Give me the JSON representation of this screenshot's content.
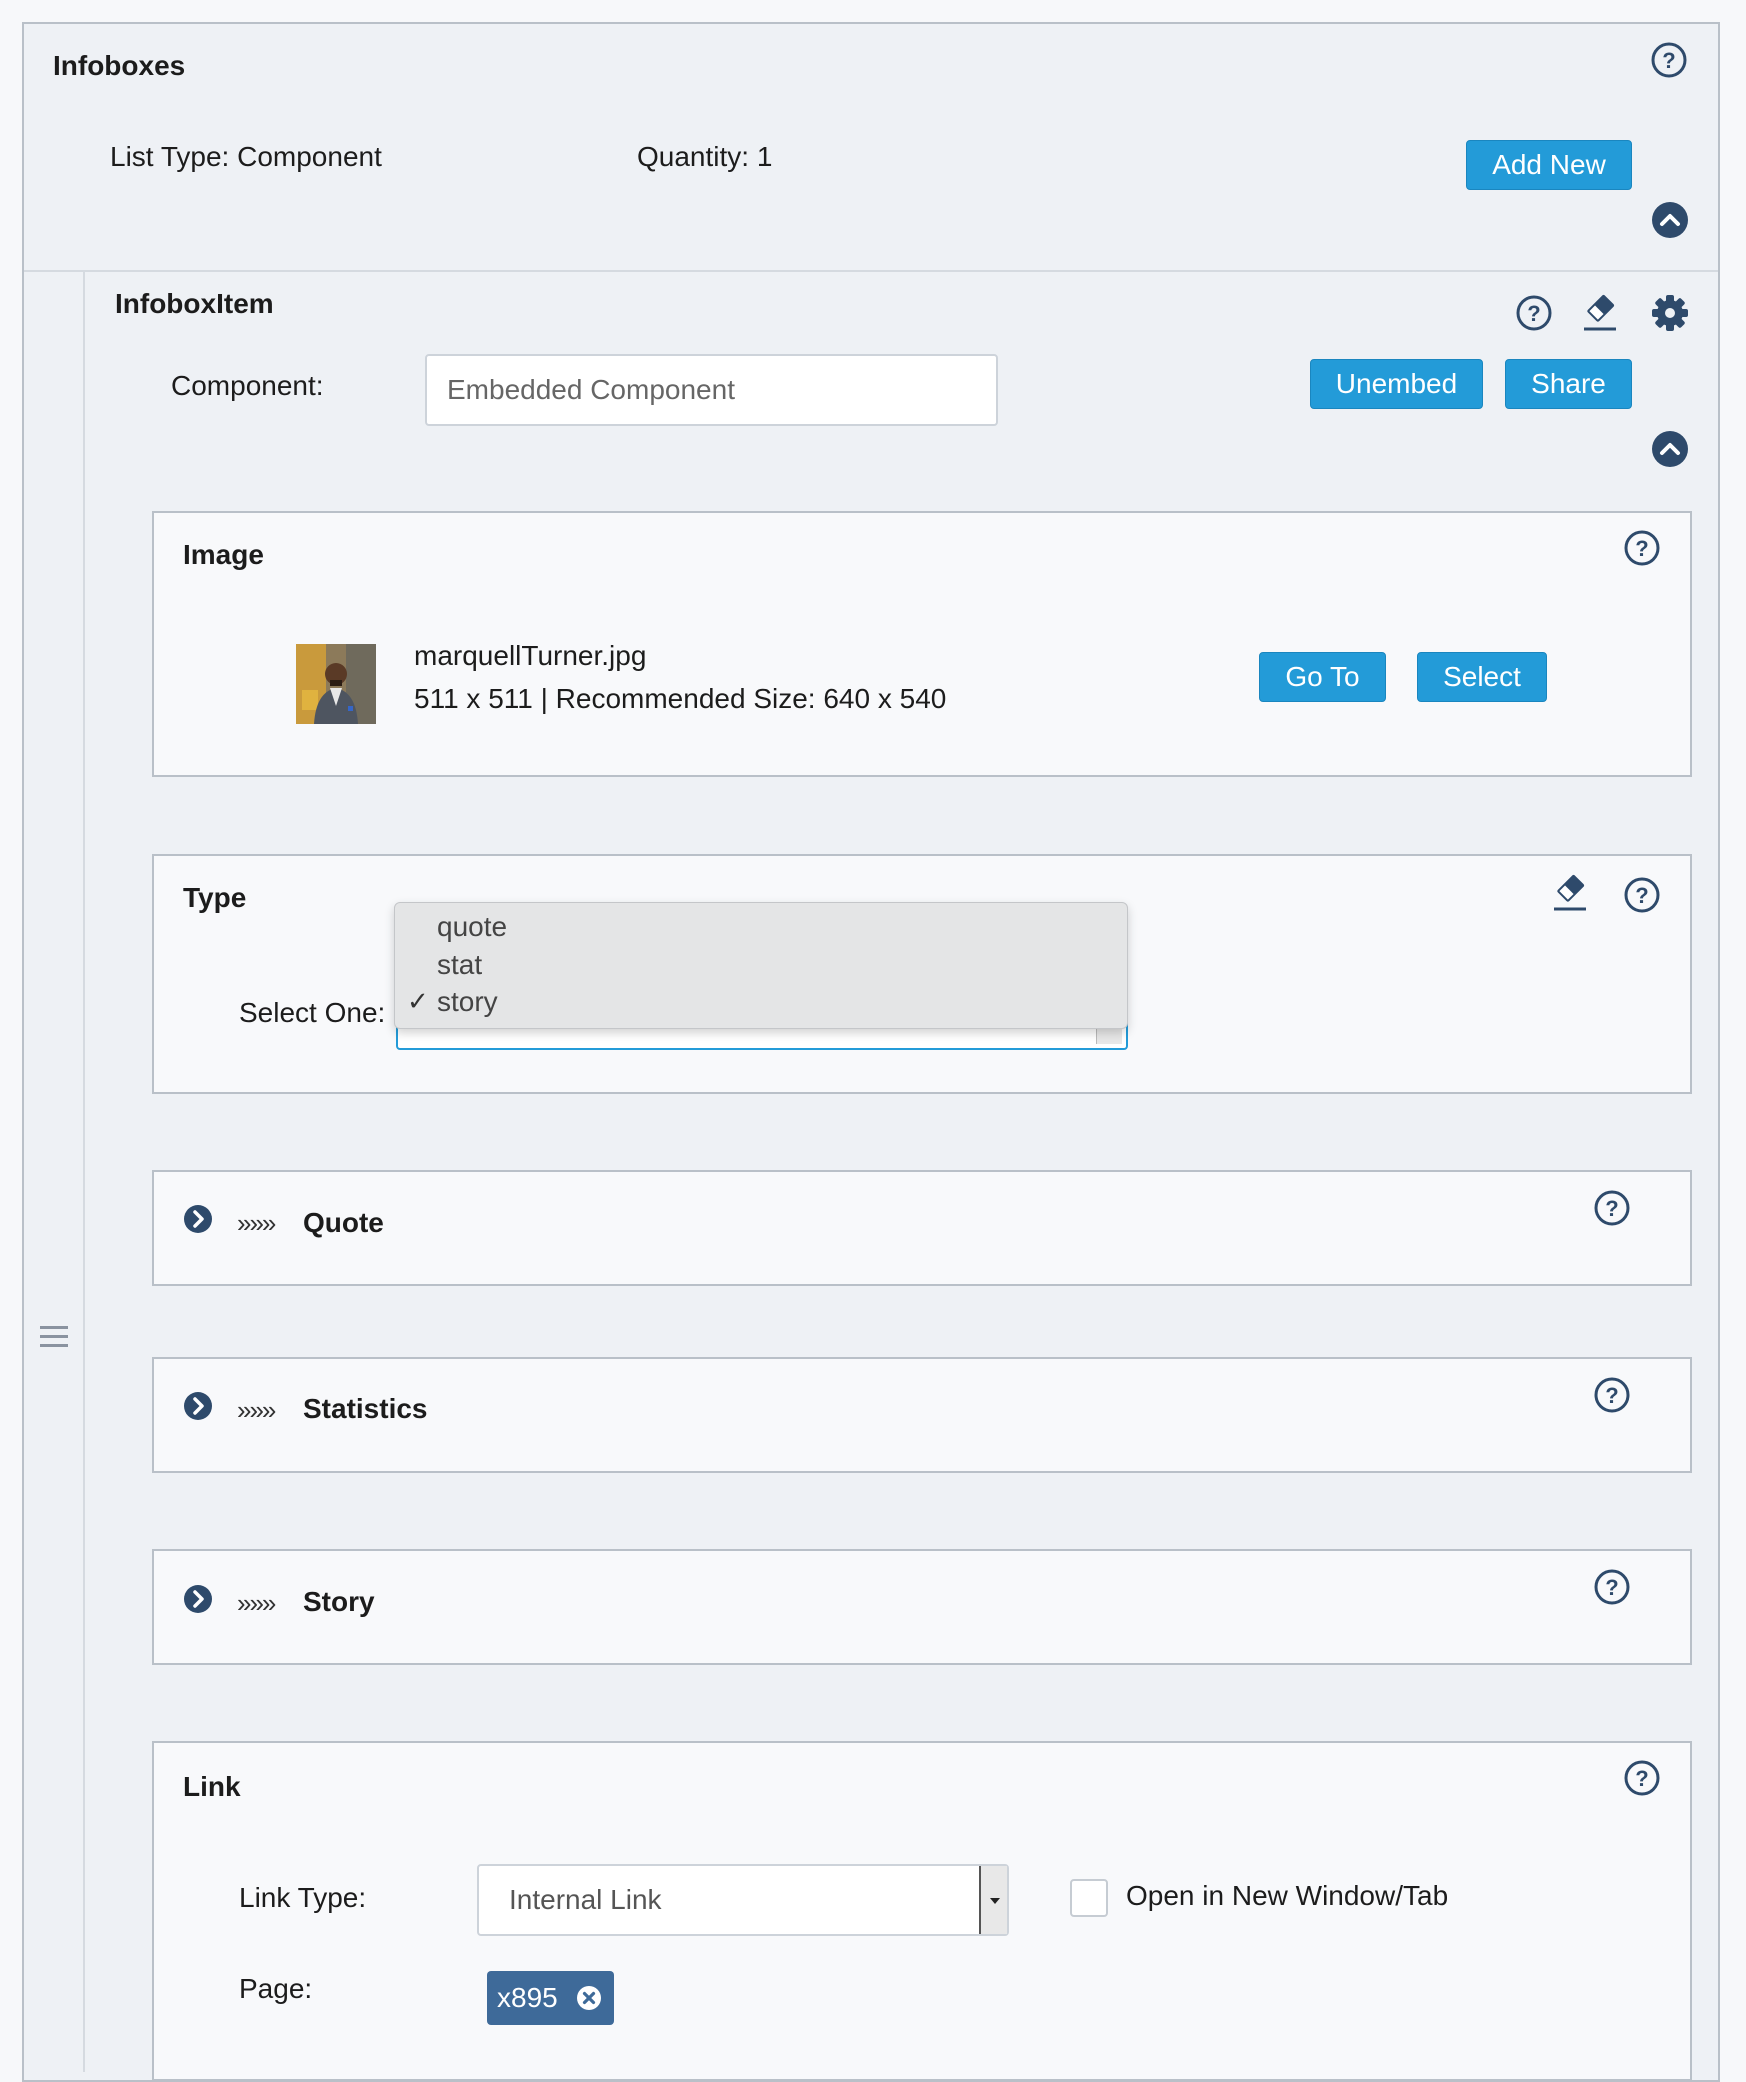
{
  "infoboxes": {
    "title": "Infoboxes",
    "list_type": "List Type: Component",
    "quantity": "Quantity: 1",
    "add_new_label": "Add New"
  },
  "item": {
    "title": "InfoboxItem",
    "component_label": "Component:",
    "component_value": "Embedded Component",
    "unembed_label": "Unembed",
    "share_label": "Share"
  },
  "image": {
    "title": "Image",
    "filename": "marquellTurner.jpg",
    "dimensions": "511 x 511 | Recommended Size: 640 x 540",
    "goto_label": "Go To",
    "select_label": "Select"
  },
  "type": {
    "title": "Type",
    "select_label": "Select One:",
    "options": [
      "quote",
      "stat",
      "story"
    ],
    "selected": "story",
    "check_mark": "✓"
  },
  "sections": {
    "quote": {
      "arrows": "»»»",
      "title": "Quote"
    },
    "statistics": {
      "arrows": "»»»",
      "title": "Statistics"
    },
    "story": {
      "arrows": "»»»",
      "title": "Story"
    }
  },
  "link": {
    "title": "Link",
    "link_type_label": "Link Type:",
    "link_type_value": "Internal Link",
    "open_new_label": "Open in New Window/Tab",
    "page_label": "Page:",
    "page_tag": "x895"
  },
  "colors": {
    "accent": "#239bd8",
    "icon_dark": "#2e4a6b",
    "tag": "#3e6a99",
    "panel_border": "#b9c0c8"
  },
  "icons": [
    "help-icon",
    "collapse-up-icon",
    "eraser-icon",
    "gear-icon",
    "expand-right-icon",
    "drag-handle-icon",
    "remove-tag-icon"
  ]
}
